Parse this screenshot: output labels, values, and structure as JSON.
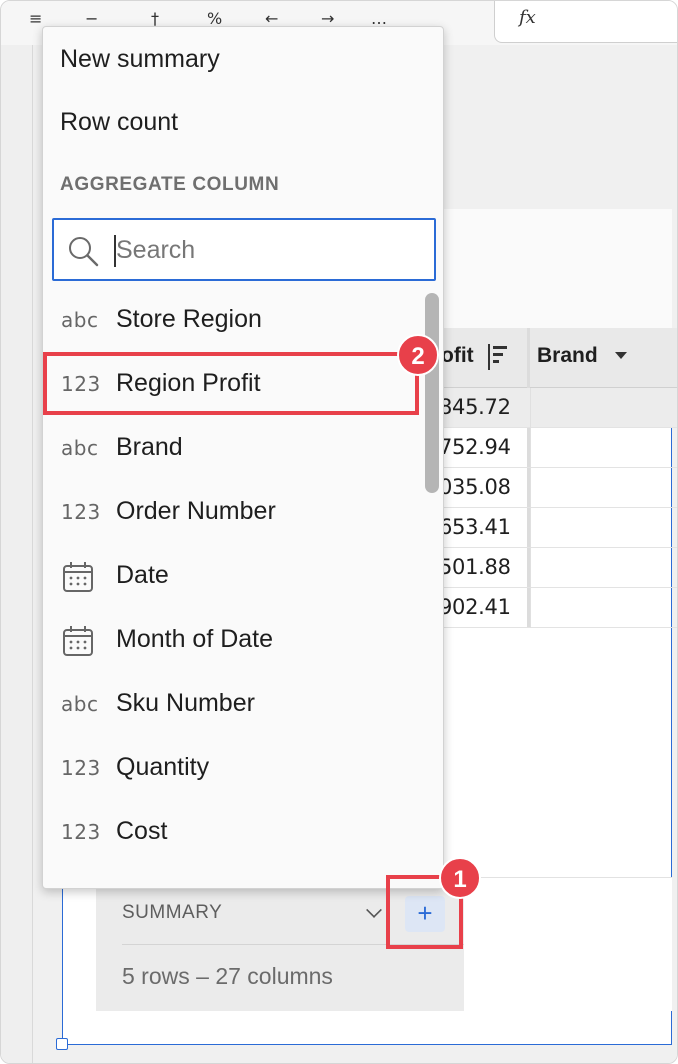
{
  "formula_bar": {
    "fx_label": "fx"
  },
  "table": {
    "headers": {
      "profit": "ofit",
      "brand": "Brand"
    },
    "rows": [
      "845.72",
      "752.94",
      "035.08",
      "653.41",
      "501.88",
      "902.41"
    ]
  },
  "summary": {
    "label": "SUMMARY",
    "add_label": "+",
    "row_info": "5 rows – 27 columns"
  },
  "menu": {
    "items": [
      "New summary",
      "Row count"
    ],
    "section_label": "AGGREGATE COLUMN",
    "search_placeholder": "Search",
    "columns": [
      {
        "type": "abc",
        "label": "Store Region",
        "icon": "text-type-icon"
      },
      {
        "type": "123",
        "label": "Region Profit",
        "icon": "number-type-icon",
        "highlighted": true
      },
      {
        "type": "abc",
        "label": "Brand",
        "icon": "text-type-icon"
      },
      {
        "type": "123",
        "label": "Order Number",
        "icon": "number-type-icon"
      },
      {
        "type": "",
        "label": "Date",
        "icon": "calendar-icon"
      },
      {
        "type": "",
        "label": "Month of Date",
        "icon": "calendar-icon"
      },
      {
        "type": "abc",
        "label": "Sku Number",
        "icon": "text-type-icon"
      },
      {
        "type": "123",
        "label": "Quantity",
        "icon": "number-type-icon"
      },
      {
        "type": "123",
        "label": "Cost",
        "icon": "number-type-icon"
      }
    ]
  },
  "annotations": {
    "step1": "1",
    "step2": "2"
  },
  "colors": {
    "accent": "#2b6bd6",
    "highlight": "#e8404a"
  }
}
